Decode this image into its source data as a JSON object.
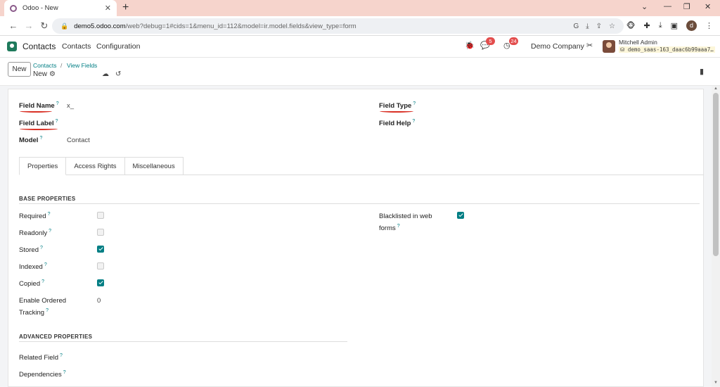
{
  "browser": {
    "tab_title": "Odoo - New",
    "url_domain": "demo5.odoo.com",
    "url_path": "/web?debug=1#cids=1&menu_id=112&model=ir.model.fields&view_type=form",
    "profile_initial": "d"
  },
  "navbar": {
    "app_name": "Contacts",
    "menu": [
      "Contacts",
      "Configuration"
    ],
    "messages_count": "5",
    "activities_count": "24",
    "company": "Demo Company",
    "user_name": "Mitchell Admin",
    "db_name": "demo_saas-163_daac6b99aaa7…"
  },
  "control": {
    "new_label": "New",
    "breadcrumb": [
      "Contacts",
      "View Fields"
    ],
    "record_name": "New"
  },
  "form": {
    "field_name_label": "Field Name",
    "field_name_value": "x_",
    "field_label_label": "Field Label",
    "model_label": "Model",
    "model_value": "Contact",
    "field_type_label": "Field Type",
    "field_help_label": "Field Help",
    "help_mark": "?"
  },
  "tabs": [
    "Properties",
    "Access Rights",
    "Miscellaneous"
  ],
  "base_properties": {
    "title": "BASE PROPERTIES",
    "required": {
      "label": "Required",
      "checked": false
    },
    "readonly": {
      "label": "Readonly",
      "checked": false
    },
    "stored": {
      "label": "Stored",
      "checked": true
    },
    "indexed": {
      "label": "Indexed",
      "checked": false
    },
    "copied": {
      "label": "Copied",
      "checked": true
    },
    "tracking": {
      "label_line1": "Enable Ordered",
      "label_line2": "Tracking",
      "value": "0"
    },
    "blacklisted": {
      "label_line1": "Blacklisted in web",
      "label_line2": "forms",
      "checked": true
    }
  },
  "advanced_properties": {
    "title": "ADVANCED PROPERTIES",
    "related_field": "Related Field",
    "dependencies": "Dependencies"
  }
}
